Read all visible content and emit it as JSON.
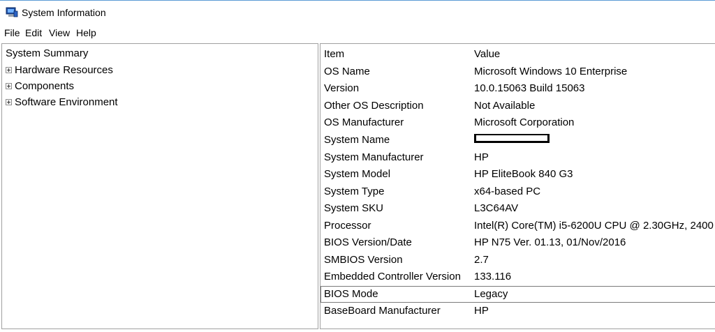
{
  "window": {
    "title": "System Information",
    "icon": "system-information-icon"
  },
  "menu": [
    "File",
    "Edit",
    "View",
    "Help"
  ],
  "tree": {
    "root": "System Summary",
    "children": [
      "Hardware Resources",
      "Components",
      "Software Environment"
    ]
  },
  "table": {
    "headers": [
      "Item",
      "Value"
    ],
    "rows": [
      [
        "OS Name",
        "Microsoft Windows 10 Enterprise"
      ],
      [
        "Version",
        "10.0.15063 Build 15063"
      ],
      [
        "Other OS Description",
        "Not Available"
      ],
      [
        "OS Manufacturer",
        "Microsoft Corporation"
      ],
      [
        "System Name",
        ""
      ],
      [
        "System Manufacturer",
        "HP"
      ],
      [
        "System Model",
        "HP EliteBook 840 G3"
      ],
      [
        "System Type",
        "x64-based PC"
      ],
      [
        "System SKU",
        "L3C64AV"
      ],
      [
        "Processor",
        "Intel(R) Core(TM) i5-6200U CPU @ 2.30GHz, 2400 ..."
      ],
      [
        "BIOS Version/Date",
        "HP N75 Ver. 01.13, 01/Nov/2016"
      ],
      [
        "SMBIOS Version",
        "2.7"
      ],
      [
        "Embedded Controller Version",
        "133.116"
      ],
      [
        "BIOS Mode",
        "Legacy"
      ],
      [
        "BaseBoard Manufacturer",
        "HP"
      ]
    ]
  }
}
